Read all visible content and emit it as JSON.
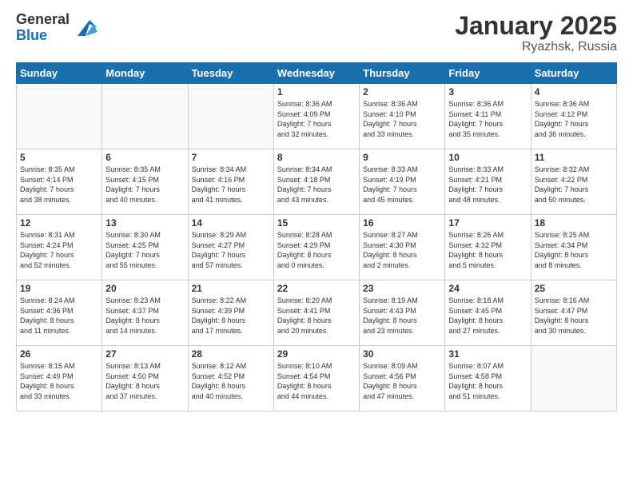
{
  "logo": {
    "general": "General",
    "blue": "Blue"
  },
  "title": "January 2025",
  "location": "Ryazhsk, Russia",
  "weekdays": [
    "Sunday",
    "Monday",
    "Tuesday",
    "Wednesday",
    "Thursday",
    "Friday",
    "Saturday"
  ],
  "weeks": [
    [
      {
        "day": "",
        "info": ""
      },
      {
        "day": "",
        "info": ""
      },
      {
        "day": "",
        "info": ""
      },
      {
        "day": "1",
        "info": "Sunrise: 8:36 AM\nSunset: 4:09 PM\nDaylight: 7 hours\nand 32 minutes."
      },
      {
        "day": "2",
        "info": "Sunrise: 8:36 AM\nSunset: 4:10 PM\nDaylight: 7 hours\nand 33 minutes."
      },
      {
        "day": "3",
        "info": "Sunrise: 8:36 AM\nSunset: 4:11 PM\nDaylight: 7 hours\nand 35 minutes."
      },
      {
        "day": "4",
        "info": "Sunrise: 8:36 AM\nSunset: 4:12 PM\nDaylight: 7 hours\nand 36 minutes."
      }
    ],
    [
      {
        "day": "5",
        "info": "Sunrise: 8:35 AM\nSunset: 4:14 PM\nDaylight: 7 hours\nand 38 minutes."
      },
      {
        "day": "6",
        "info": "Sunrise: 8:35 AM\nSunset: 4:15 PM\nDaylight: 7 hours\nand 40 minutes."
      },
      {
        "day": "7",
        "info": "Sunrise: 8:34 AM\nSunset: 4:16 PM\nDaylight: 7 hours\nand 41 minutes."
      },
      {
        "day": "8",
        "info": "Sunrise: 8:34 AM\nSunset: 4:18 PM\nDaylight: 7 hours\nand 43 minutes."
      },
      {
        "day": "9",
        "info": "Sunrise: 8:33 AM\nSunset: 4:19 PM\nDaylight: 7 hours\nand 45 minutes."
      },
      {
        "day": "10",
        "info": "Sunrise: 8:33 AM\nSunset: 4:21 PM\nDaylight: 7 hours\nand 48 minutes."
      },
      {
        "day": "11",
        "info": "Sunrise: 8:32 AM\nSunset: 4:22 PM\nDaylight: 7 hours\nand 50 minutes."
      }
    ],
    [
      {
        "day": "12",
        "info": "Sunrise: 8:31 AM\nSunset: 4:24 PM\nDaylight: 7 hours\nand 52 minutes."
      },
      {
        "day": "13",
        "info": "Sunrise: 8:30 AM\nSunset: 4:25 PM\nDaylight: 7 hours\nand 55 minutes."
      },
      {
        "day": "14",
        "info": "Sunrise: 8:29 AM\nSunset: 4:27 PM\nDaylight: 7 hours\nand 57 minutes."
      },
      {
        "day": "15",
        "info": "Sunrise: 8:28 AM\nSunset: 4:29 PM\nDaylight: 8 hours\nand 0 minutes."
      },
      {
        "day": "16",
        "info": "Sunrise: 8:27 AM\nSunset: 4:30 PM\nDaylight: 8 hours\nand 2 minutes."
      },
      {
        "day": "17",
        "info": "Sunrise: 8:26 AM\nSunset: 4:32 PM\nDaylight: 8 hours\nand 5 minutes."
      },
      {
        "day": "18",
        "info": "Sunrise: 8:25 AM\nSunset: 4:34 PM\nDaylight: 8 hours\nand 8 minutes."
      }
    ],
    [
      {
        "day": "19",
        "info": "Sunrise: 8:24 AM\nSunset: 4:36 PM\nDaylight: 8 hours\nand 11 minutes."
      },
      {
        "day": "20",
        "info": "Sunrise: 8:23 AM\nSunset: 4:37 PM\nDaylight: 8 hours\nand 14 minutes."
      },
      {
        "day": "21",
        "info": "Sunrise: 8:22 AM\nSunset: 4:39 PM\nDaylight: 8 hours\nand 17 minutes."
      },
      {
        "day": "22",
        "info": "Sunrise: 8:20 AM\nSunset: 4:41 PM\nDaylight: 8 hours\nand 20 minutes."
      },
      {
        "day": "23",
        "info": "Sunrise: 8:19 AM\nSunset: 4:43 PM\nDaylight: 8 hours\nand 23 minutes."
      },
      {
        "day": "24",
        "info": "Sunrise: 8:18 AM\nSunset: 4:45 PM\nDaylight: 8 hours\nand 27 minutes."
      },
      {
        "day": "25",
        "info": "Sunrise: 8:16 AM\nSunset: 4:47 PM\nDaylight: 8 hours\nand 30 minutes."
      }
    ],
    [
      {
        "day": "26",
        "info": "Sunrise: 8:15 AM\nSunset: 4:49 PM\nDaylight: 8 hours\nand 33 minutes."
      },
      {
        "day": "27",
        "info": "Sunrise: 8:13 AM\nSunset: 4:50 PM\nDaylight: 8 hours\nand 37 minutes."
      },
      {
        "day": "28",
        "info": "Sunrise: 8:12 AM\nSunset: 4:52 PM\nDaylight: 8 hours\nand 40 minutes."
      },
      {
        "day": "29",
        "info": "Sunrise: 8:10 AM\nSunset: 4:54 PM\nDaylight: 8 hours\nand 44 minutes."
      },
      {
        "day": "30",
        "info": "Sunrise: 8:09 AM\nSunset: 4:56 PM\nDaylight: 8 hours\nand 47 minutes."
      },
      {
        "day": "31",
        "info": "Sunrise: 8:07 AM\nSunset: 4:58 PM\nDaylight: 8 hours\nand 51 minutes."
      },
      {
        "day": "",
        "info": ""
      }
    ]
  ]
}
